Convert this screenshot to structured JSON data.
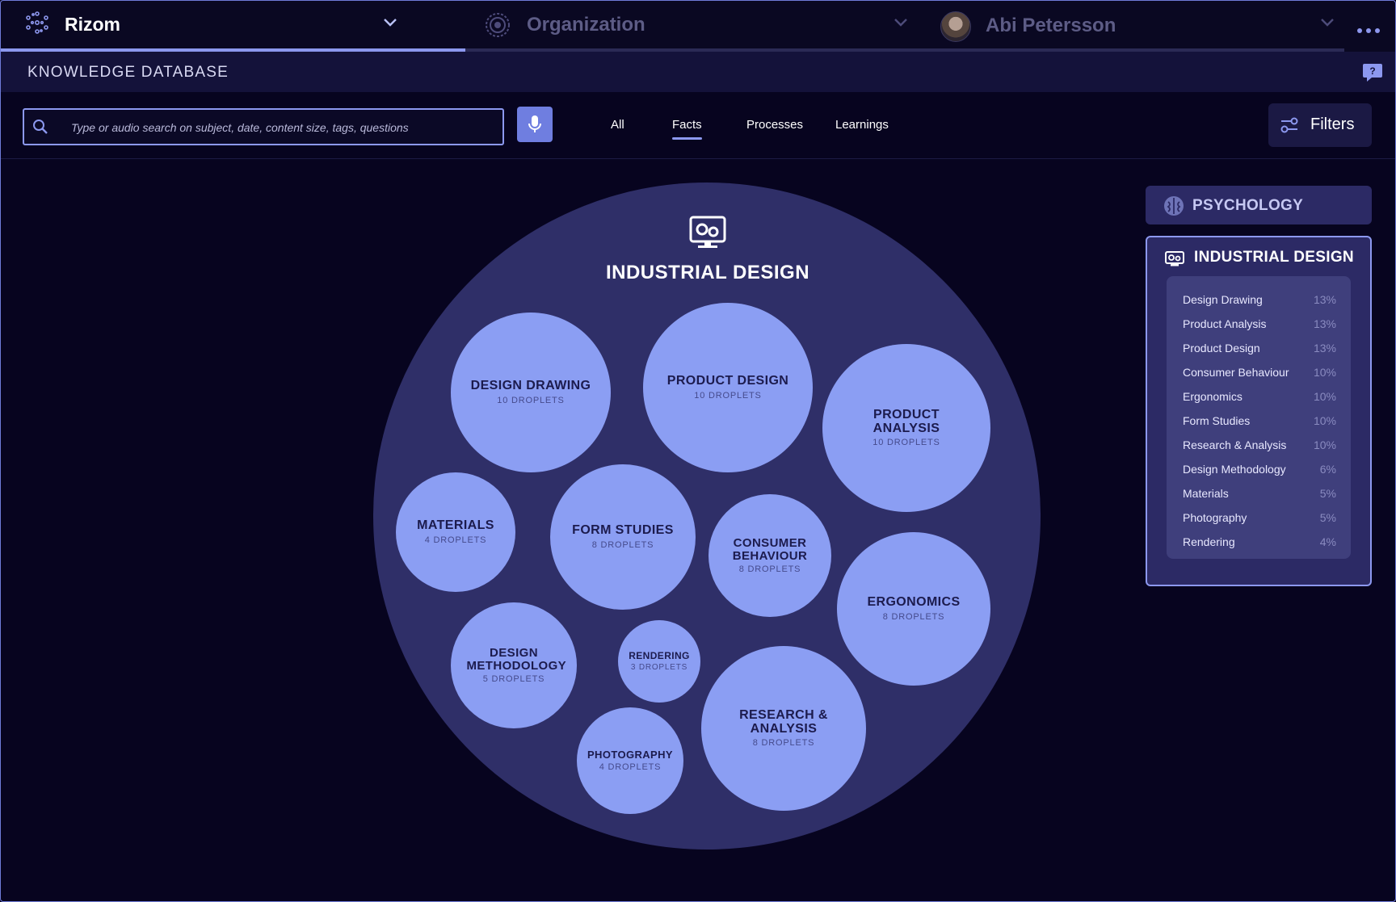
{
  "topbar": {
    "brand": "Rizom",
    "organization": "Organization",
    "user_name": "Abi Petersson"
  },
  "header": {
    "title": "KNOWLEDGE DATABASE"
  },
  "search": {
    "placeholder": "Type or audio search on subject, date, content size, tags, questions",
    "tabs": [
      "All",
      "Facts",
      "Processes",
      "Learnings"
    ],
    "active_tab": "Facts",
    "filters_label": "Filters"
  },
  "chart_data": {
    "type": "bubble",
    "title": "INDUSTRIAL DESIGN",
    "bubbles": [
      {
        "name": "DESIGN DRAWING",
        "count_label": "10 DROPLETS",
        "value": 10
      },
      {
        "name": "PRODUCT DESIGN",
        "count_label": "10 DROPLETS",
        "value": 10
      },
      {
        "name": "PRODUCT ANALYSIS",
        "count_label": "10 DROPLETS",
        "value": 10
      },
      {
        "name": "MATERIALS",
        "count_label": "4 DROPLETS",
        "value": 4
      },
      {
        "name": "FORM STUDIES",
        "count_label": "8 DROPLETS",
        "value": 8
      },
      {
        "name": "CONSUMER BEHAVIOUR",
        "count_label": "8 DROPLETS",
        "value": 8
      },
      {
        "name": "ERGONOMICS",
        "count_label": "8 DROPLETS",
        "value": 8
      },
      {
        "name": "DESIGN METHODOLOGY",
        "count_label": "5 DROPLETS",
        "value": 5
      },
      {
        "name": "RENDERING",
        "count_label": "3 DROPLETS",
        "value": 3
      },
      {
        "name": "RESEARCH & ANALYSIS",
        "count_label": "8 DROPLETS",
        "value": 8
      },
      {
        "name": "PHOTOGRAPHY",
        "count_label": "4 DROPLETS",
        "value": 4
      }
    ]
  },
  "sidebar": {
    "categories": [
      {
        "label": "PSYCHOLOGY",
        "icon": "brain-icon",
        "selected": false
      },
      {
        "label": "INDUSTRIAL DESIGN",
        "icon": "design-gear-icon",
        "selected": true
      }
    ],
    "breakdown": [
      {
        "name": "Design Drawing",
        "pct": "13%"
      },
      {
        "name": "Product Analysis",
        "pct": "13%"
      },
      {
        "name": "Product Design",
        "pct": "13%"
      },
      {
        "name": "Consumer Behaviour",
        "pct": "10%"
      },
      {
        "name": "Ergonomics",
        "pct": "10%"
      },
      {
        "name": "Form Studies",
        "pct": "10%"
      },
      {
        "name": "Research & Analysis",
        "pct": "10%"
      },
      {
        "name": "Design Methodology",
        "pct": "6%"
      },
      {
        "name": "Materials",
        "pct": "5%"
      },
      {
        "name": "Photography",
        "pct": "5%"
      },
      {
        "name": "Rendering",
        "pct": "4%"
      }
    ]
  },
  "colors": {
    "background": "#07041f",
    "accent": "#8c98ef",
    "bubble": "#8b9ef3",
    "container": "#2f2f68",
    "mic": "#6f7ee0"
  }
}
